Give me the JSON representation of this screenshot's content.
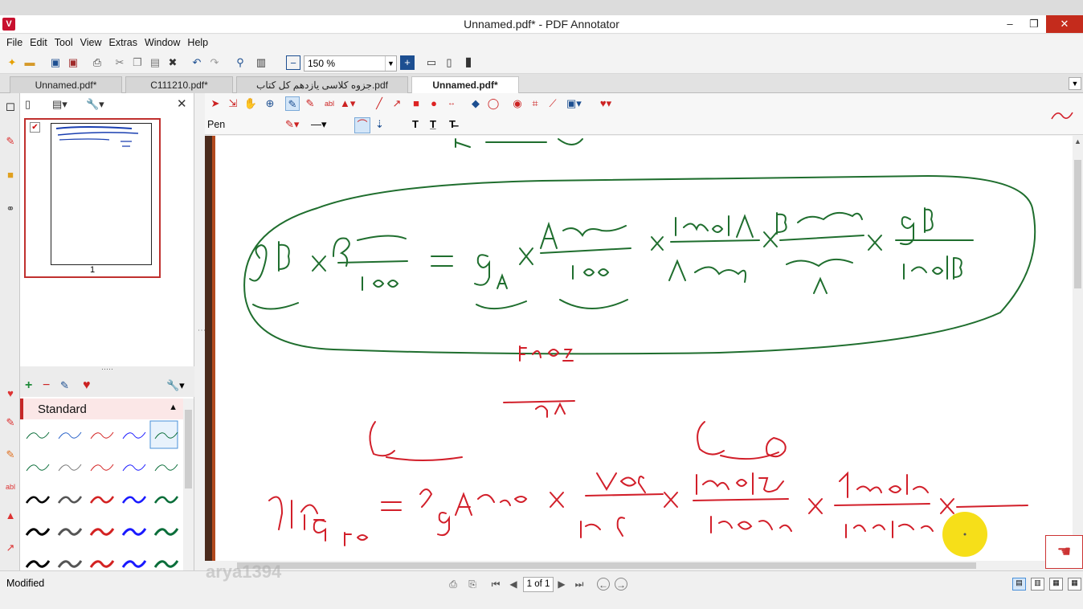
{
  "window": {
    "title": "Unnamed.pdf* - PDF Annotator",
    "minimize": "–",
    "maximize": "❐",
    "close": "✕"
  },
  "menu": [
    "File",
    "Edit",
    "Tool",
    "View",
    "Extras",
    "Window",
    "Help"
  ],
  "toolbar": {
    "zoom": "150 %"
  },
  "tabs": [
    {
      "label": "Unnamed.pdf*",
      "active": false
    },
    {
      "label": "C111210.pdf*",
      "active": false
    },
    {
      "label": "جزوه کلاسی یازدهم کل کتاب.pdf",
      "active": false
    },
    {
      "label": "Unnamed.pdf*",
      "active": true
    }
  ],
  "thumbnails": {
    "page_number": "1"
  },
  "favorites": {
    "header": "Standard",
    "pen_colors": [
      "#0b6e3a",
      "#2a63c9",
      "#d32222",
      "#1a1aff",
      "#0b6e3a"
    ],
    "selected_slot": 2
  },
  "annotation_toolbar": {
    "tool_label": "Pen"
  },
  "document": {
    "ink_green": "#1f6e2e",
    "ink_red": "#d21f2a",
    "highlight": "#f5dc00"
  },
  "statusbar": {
    "status": "Modified",
    "page": "1 of 1",
    "watermark": "arya1394"
  }
}
